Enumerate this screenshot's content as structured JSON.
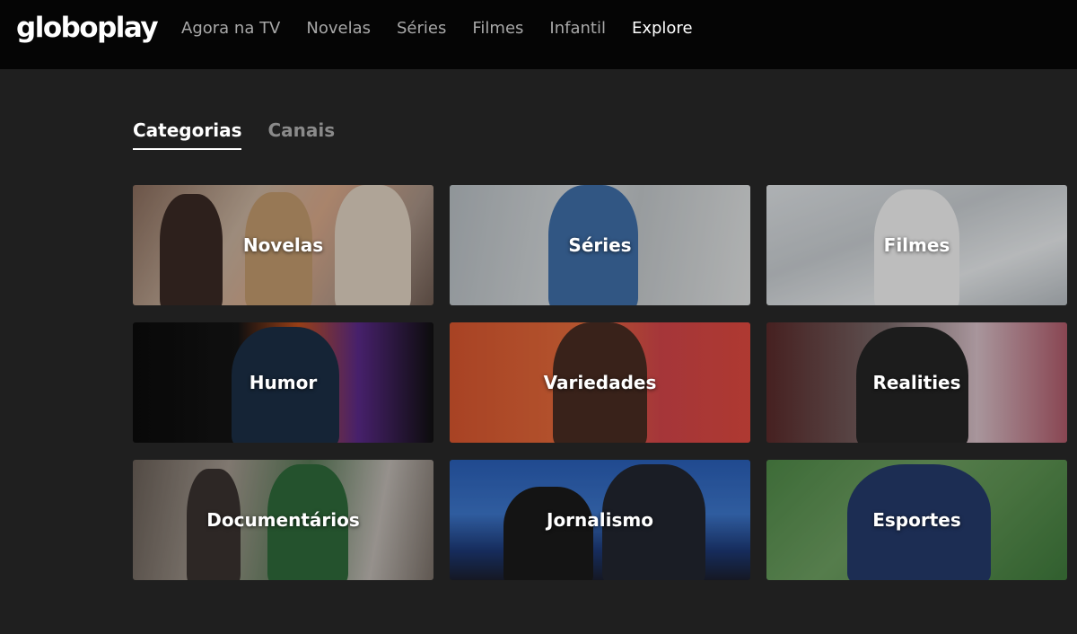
{
  "header": {
    "logo": "globoplay",
    "nav": [
      {
        "label": "Agora na TV",
        "active": false
      },
      {
        "label": "Novelas",
        "active": false
      },
      {
        "label": "Séries",
        "active": false
      },
      {
        "label": "Filmes",
        "active": false
      },
      {
        "label": "Infantil",
        "active": false
      },
      {
        "label": "Explore",
        "active": true
      }
    ]
  },
  "tabs": [
    {
      "label": "Categorias",
      "active": true
    },
    {
      "label": "Canais",
      "active": false
    }
  ],
  "categories": [
    {
      "label": "Novelas"
    },
    {
      "label": "Séries"
    },
    {
      "label": "Filmes"
    },
    {
      "label": "Humor"
    },
    {
      "label": "Variedades"
    },
    {
      "label": "Realities"
    },
    {
      "label": "Documentários"
    },
    {
      "label": "Jornalismo"
    },
    {
      "label": "Esportes"
    }
  ],
  "colors": {
    "header_bg": "#050505",
    "page_bg": "#1f1f1f",
    "nav_inactive": "#a8a8a8",
    "nav_active": "#ffffff"
  }
}
